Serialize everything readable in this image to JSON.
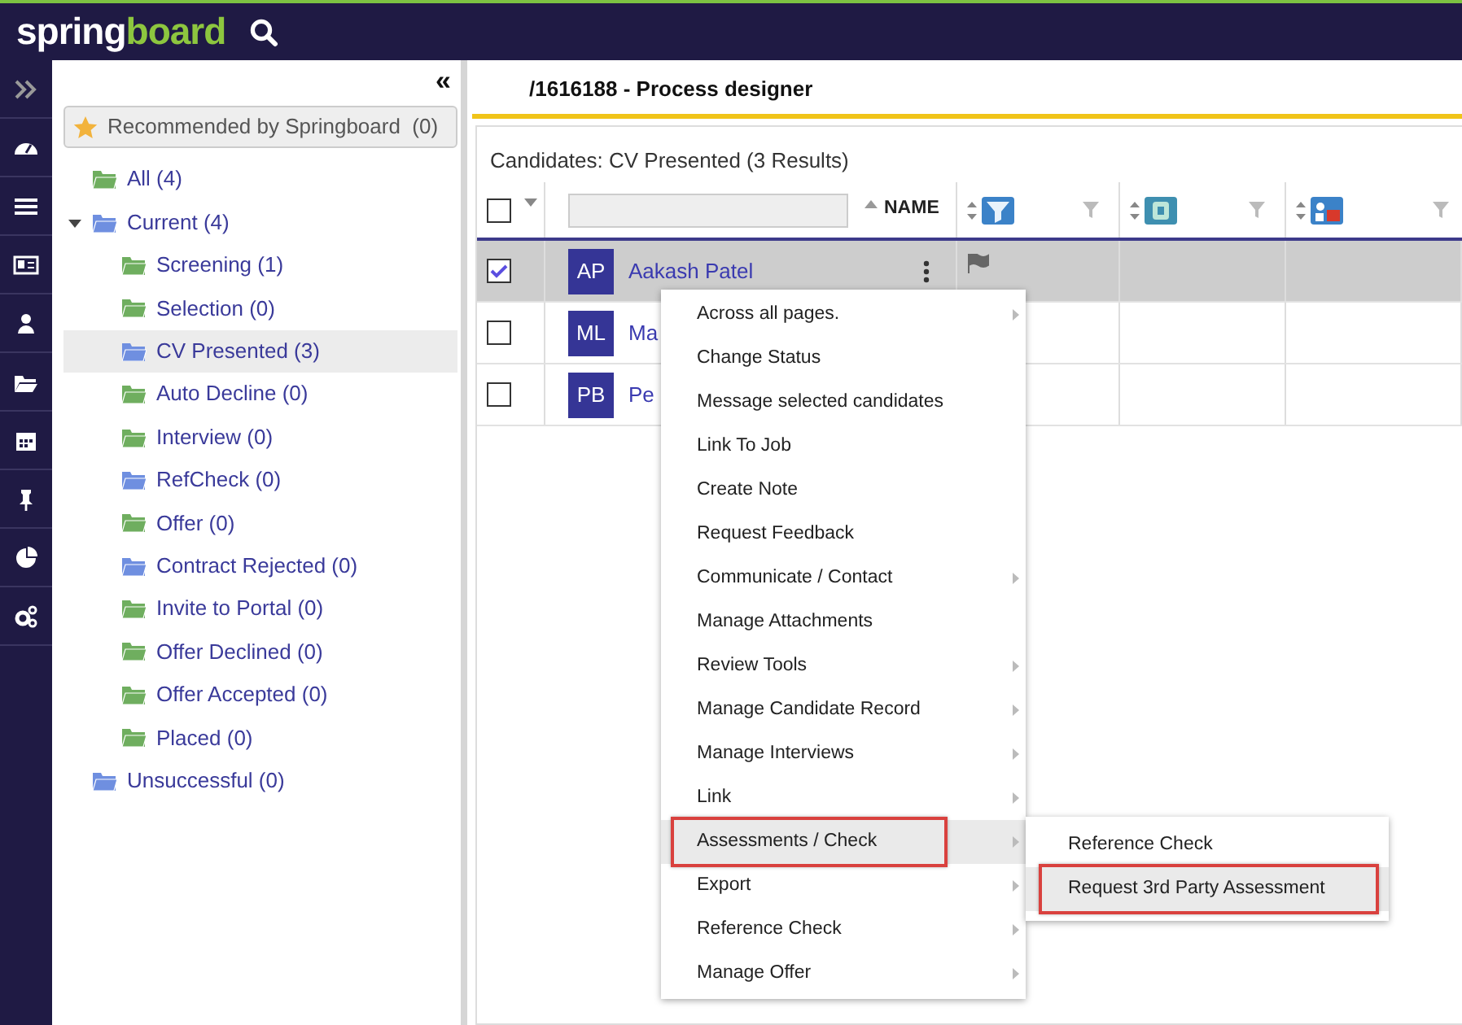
{
  "topbar": {
    "logo_light": "spring",
    "logo_accent": "board"
  },
  "tree": {
    "collapse": "«",
    "recommended": "Recommended by Springboard  (0)",
    "items": [
      {
        "label": "All (4)",
        "color": "#6fae5f",
        "selected": false
      },
      {
        "label": "Current (4)",
        "color": "#6f8fe0",
        "selected": false,
        "expanded": true,
        "children": [
          {
            "label": "Screening (1)",
            "color": "#6fae5f",
            "selected": false
          },
          {
            "label": "Selection (0)",
            "color": "#6fae5f",
            "selected": false
          },
          {
            "label": "CV Presented (3)",
            "color": "#6f8fe0",
            "selected": true
          },
          {
            "label": "Auto Decline (0)",
            "color": "#6fae5f",
            "selected": false
          },
          {
            "label": "Interview (0)",
            "color": "#6fae5f",
            "selected": false
          },
          {
            "label": "RefCheck (0)",
            "color": "#6f8fe0",
            "selected": false
          },
          {
            "label": "Offer (0)",
            "color": "#6fae5f",
            "selected": false
          },
          {
            "label": "Contract Rejected (0)",
            "color": "#6f8fe0",
            "selected": false
          },
          {
            "label": "Invite to Portal (0)",
            "color": "#6fae5f",
            "selected": false
          },
          {
            "label": "Offer Declined (0)",
            "color": "#6fae5f",
            "selected": false
          },
          {
            "label": "Offer Accepted (0)",
            "color": "#6fae5f",
            "selected": false
          },
          {
            "label": "Placed (0)",
            "color": "#6fae5f",
            "selected": false
          }
        ]
      },
      {
        "label": "Unsuccessful (0)",
        "color": "#6f8fe0",
        "selected": false
      }
    ]
  },
  "page_title": "/1616188 - Process designer",
  "results": "Candidates: CV Presented (3 Results)",
  "table": {
    "name_column": "NAME",
    "header_checked": false,
    "rows": [
      {
        "initials": "AP",
        "name": "Aakash Patel",
        "checked": true,
        "selected": true,
        "flag": true
      },
      {
        "initials": "ML",
        "name": "Ma",
        "checked": false,
        "selected": false,
        "flag": false
      },
      {
        "initials": "PB",
        "name": "Pe",
        "checked": false,
        "selected": false,
        "flag": false
      }
    ]
  },
  "menu": [
    {
      "label": "Across all pages.",
      "submenu": true,
      "highlighted": false,
      "outlined": false
    },
    {
      "label": "Change Status",
      "submenu": false,
      "highlighted": false,
      "outlined": false
    },
    {
      "label": "Message selected candidates",
      "submenu": false,
      "highlighted": false,
      "outlined": false
    },
    {
      "label": "Link To Job",
      "submenu": false,
      "highlighted": false,
      "outlined": false
    },
    {
      "label": "Create Note",
      "submenu": false,
      "highlighted": false,
      "outlined": false
    },
    {
      "label": "Request Feedback",
      "submenu": false,
      "highlighted": false,
      "outlined": false
    },
    {
      "label": "Communicate / Contact",
      "submenu": true,
      "highlighted": false,
      "outlined": false
    },
    {
      "label": "Manage Attachments",
      "submenu": false,
      "highlighted": false,
      "outlined": false
    },
    {
      "label": "Review Tools",
      "submenu": true,
      "highlighted": false,
      "outlined": false
    },
    {
      "label": "Manage Candidate Record",
      "submenu": true,
      "highlighted": false,
      "outlined": false
    },
    {
      "label": "Manage Interviews",
      "submenu": true,
      "highlighted": false,
      "outlined": false
    },
    {
      "label": "Link",
      "submenu": true,
      "highlighted": false,
      "outlined": false
    },
    {
      "label": "Assessments / Check",
      "submenu": true,
      "highlighted": true,
      "outlined": true
    },
    {
      "label": "Export",
      "submenu": true,
      "highlighted": false,
      "outlined": false
    },
    {
      "label": "Reference Check",
      "submenu": true,
      "highlighted": false,
      "outlined": false
    },
    {
      "label": "Manage Offer",
      "submenu": true,
      "highlighted": false,
      "outlined": false
    }
  ],
  "submenu": [
    {
      "label": "Reference Check",
      "highlighted": false,
      "outlined": false
    },
    {
      "label": "Request 3rd Party Assessment",
      "highlighted": true,
      "outlined": true
    }
  ]
}
